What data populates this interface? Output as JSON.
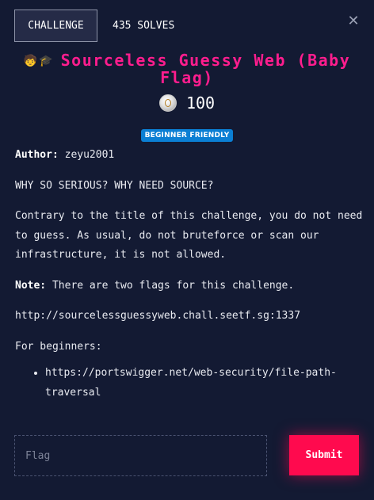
{
  "tabs": {
    "challenge": "CHALLENGE",
    "solves": "435 SOLVES"
  },
  "close_symbol": "✕",
  "title": {
    "icon_names": [
      "person-icon",
      "graduation-cap-icon"
    ],
    "text": "Sourceless Guessy Web (Baby Flag)",
    "color": "#ff1d8e"
  },
  "points": {
    "icon": "coin-icon",
    "value": "100"
  },
  "badge": {
    "label": "BEGINNER FRIENDLY",
    "color": "#0b7fd4"
  },
  "description": {
    "author_label": "Author:",
    "author_value": "zeyu2001",
    "tagline": "WHY SO SERIOUS? WHY NEED SOURCE?",
    "paragraph": "Contrary to the title of this challenge, you do not need to guess. As usual, do not bruteforce or scan our infrastructure, it is not allowed.",
    "note_label": "Note:",
    "note_text": "There are two flags for this challenge.",
    "url": "http://sourcelessguessyweb.chall.seetf.sg:1337",
    "beginners_label": "For beginners:",
    "links": [
      "https://portswigger.net/web-security/file-path-traversal"
    ]
  },
  "form": {
    "flag_placeholder": "Flag",
    "flag_value": "",
    "submit_label": "Submit",
    "submit_color": "#ff0a4e"
  }
}
